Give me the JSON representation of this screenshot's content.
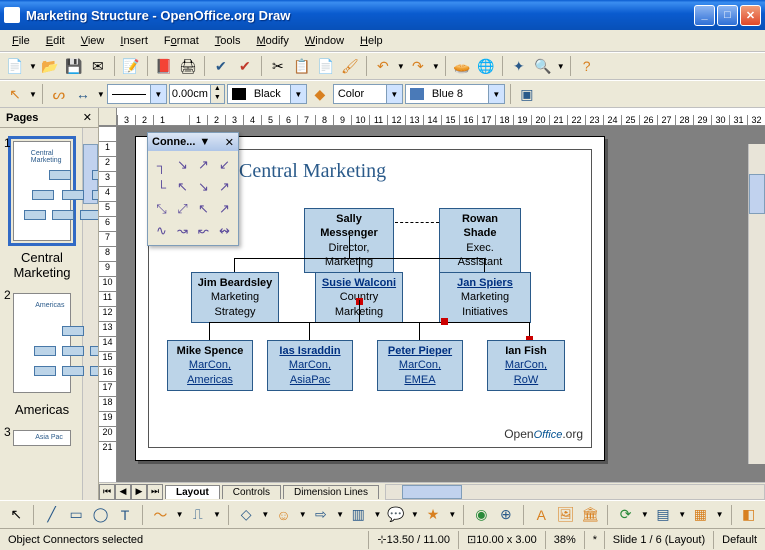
{
  "title": "Marketing Structure - OpenOffice.org Draw",
  "menu": [
    "File",
    "Edit",
    "View",
    "Insert",
    "Format",
    "Tools",
    "Modify",
    "Window",
    "Help"
  ],
  "toolbar2": {
    "line_width": "0.00cm",
    "line_color_label": "Black",
    "fill_style_label": "Color",
    "fill_color_label": "Blue 8"
  },
  "pages_panel": {
    "title": "Pages",
    "slides": [
      {
        "num": "1",
        "caption": "Central Marketing",
        "selected": true
      },
      {
        "num": "2",
        "caption": "Americas",
        "selected": false
      },
      {
        "num": "3",
        "caption": "Asia Pac",
        "selected": false
      }
    ]
  },
  "ruler_h": [
    "3",
    "2",
    "1",
    "",
    "1",
    "2",
    "3",
    "4",
    "5",
    "6",
    "7",
    "8",
    "9",
    "10",
    "11",
    "12",
    "13",
    "14",
    "15",
    "16",
    "17",
    "18",
    "19",
    "20",
    "21",
    "22",
    "23",
    "24",
    "25",
    "26",
    "27",
    "28",
    "29",
    "30",
    "31",
    "32"
  ],
  "ruler_v": [
    "",
    "1",
    "2",
    "3",
    "4",
    "5",
    "6",
    "7",
    "8",
    "9",
    "10",
    "11",
    "12",
    "13",
    "14",
    "15",
    "16",
    "17",
    "18",
    "19",
    "20",
    "21"
  ],
  "connectors_palette": {
    "title": "Conne..."
  },
  "canvas": {
    "title": "Central Marketing",
    "boxes": {
      "top1": {
        "l1": "Sally Messenger",
        "l2": "Director, Marketing"
      },
      "top2": {
        "l1": "Rowan Shade",
        "l2": "Exec. Assistant"
      },
      "mid1": {
        "l1": "Jim Beardsley",
        "l2": "Marketing Strategy"
      },
      "mid2": {
        "l1": "Susie Walconi",
        "l2": "Country Marketing"
      },
      "mid3": {
        "l1": "Jan Spiers",
        "l2": "Marketing Initiatives"
      },
      "bot1": {
        "l1": "Mike Spence",
        "l2": "MarCon, Americas"
      },
      "bot2": {
        "l1": "Ias Israddin",
        "l2": "MarCon, AsiaPac"
      },
      "bot3": {
        "l1": "Peter Pieper",
        "l2": "MarCon, EMEA"
      },
      "bot4": {
        "l1": "Ian Fish",
        "l2": "MarCon, RoW"
      }
    },
    "logo": "OpenOffice.org"
  },
  "tabs": [
    "Layout",
    "Controls",
    "Dimension Lines"
  ],
  "status": {
    "msg": "Object Connectors selected",
    "pos": "13.50 / 11.00",
    "size": "10.00 x 3.00",
    "zoom": "38%",
    "slide": "Slide 1 / 6 (Layout)",
    "layer": "Default"
  }
}
